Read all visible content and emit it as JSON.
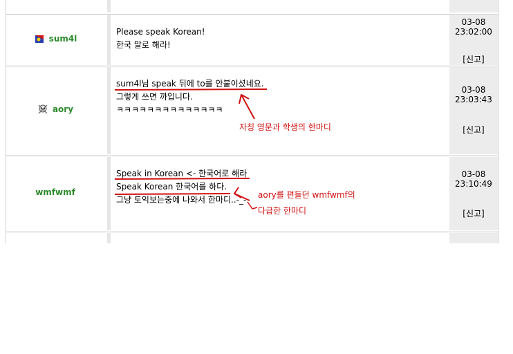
{
  "rows": [
    {
      "user": "",
      "lines": [],
      "date": "",
      "time": "",
      "report": ""
    },
    {
      "user": "sum4l",
      "icon": "flag-icon",
      "lines": [
        "Please speak Korean!",
        "한국 말로 해라!"
      ],
      "date": "03-08",
      "time": "23:02:00",
      "report": "[신고]"
    },
    {
      "user": "aory",
      "icon": "skull-icon",
      "lines": [
        "sum4l님 speak 뒤에 to를 안붙이셨네요.",
        "",
        "그렇게 쓰면 까입니다.",
        "",
        "ㅋㅋㅋㅋㅋㅋㅋㅋㅋㅋㅋㅋㅋㅋ"
      ],
      "date": "03-08",
      "time": "23:03:43",
      "report": "[신고]",
      "annotation": "자칭 영문과 학생의 한마디"
    },
    {
      "user": "wmfwmf",
      "lines": [
        "Speak in Korean <- 한국어로 해라",
        "Speak Korean 한국어를 하다.",
        "",
        "그냥 토익보는중에 나와서 한마디..-_-"
      ],
      "date": "03-08",
      "time": "23:10:49",
      "report": "[신고]",
      "annotation_1": "aory를 편들던 wmfwmf의",
      "annotation_2": "다급한 한마디"
    }
  ],
  "colors": {
    "username": "#2d8a2d",
    "annotation": "#d01010",
    "meta_bg": "#ececec"
  }
}
